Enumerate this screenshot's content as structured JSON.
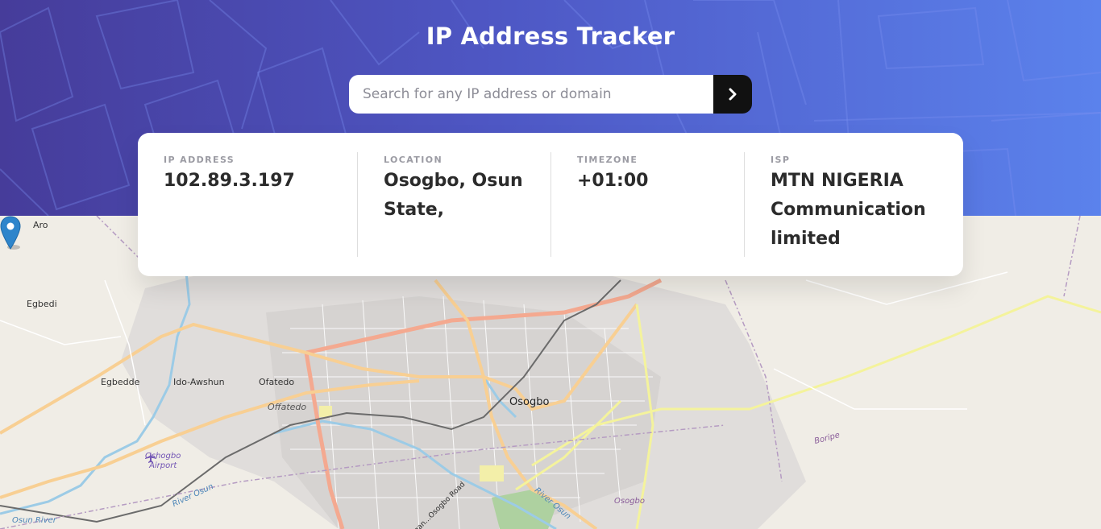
{
  "header": {
    "title": "IP Address Tracker"
  },
  "search": {
    "placeholder": "Search for any IP address or domain",
    "value": "",
    "button_icon": "chevron-right-icon"
  },
  "info": {
    "ip": {
      "label": "IP ADDRESS",
      "value": "102.89.3.197"
    },
    "location": {
      "label": "LOCATION",
      "value": "Osogbo, Osun State,"
    },
    "timezone": {
      "label": "TIMEZONE",
      "value": "+01:00"
    },
    "isp": {
      "label": "ISP",
      "value": "MTN NIGERIA Communication limited"
    }
  },
  "map": {
    "labels": {
      "aro": "Aro",
      "egbedi": "Egbedi",
      "egbedde": "Egbedde",
      "ido_awshun": "Ido-Awshun",
      "ofatedo": "Ofatedo",
      "offatedo": "Offatedo",
      "osogbo": "Osogbo",
      "osogbo_district": "Osogbo",
      "airport_line1": "Oshogbo",
      "airport_line2": "Airport",
      "river_osun": "River Osun",
      "river_osun_2": "River Osun",
      "osun_river": "Osun River",
      "boripe": "Boripe",
      "road_name": "Ogan...Osogbo Road"
    },
    "marker_icon": "location-pin-icon"
  },
  "colors": {
    "header_start": "#463c9a",
    "header_end": "#5b82ec",
    "button": "#111111",
    "text_dark": "#2b2b2b",
    "label_grey": "#9b9ba3"
  }
}
